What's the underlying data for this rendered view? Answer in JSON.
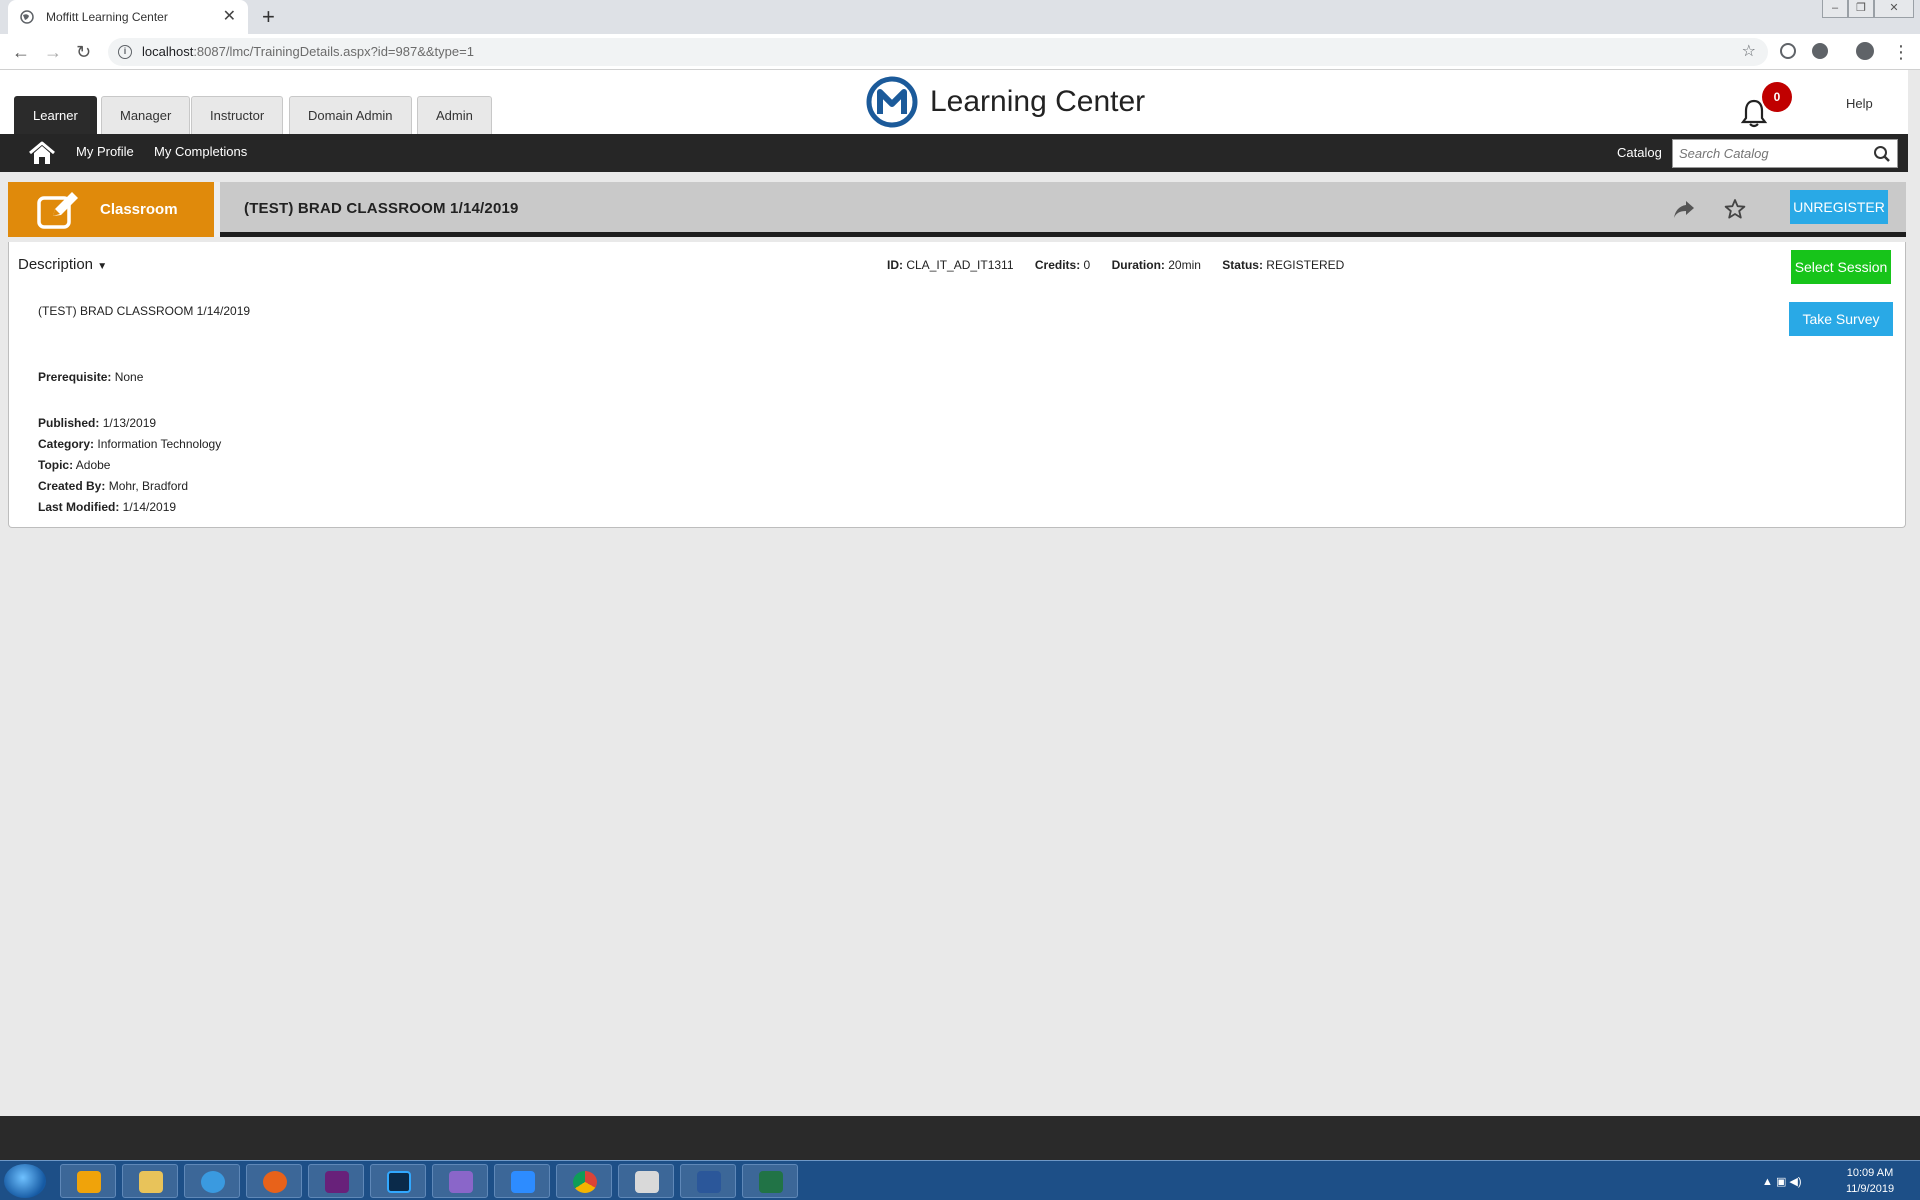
{
  "browser": {
    "tab_title": "Moffitt Learning Center",
    "tab_close": "✕",
    "new_tab": "+",
    "url_host": "localhost",
    "url_path": ":8087/lmc/TrainingDetails.aspx?id=987&&type=1"
  },
  "app": {
    "brand_name": "Learning Center",
    "role_tabs": [
      "Learner",
      "Manager",
      "Instructor",
      "Domain Admin",
      "Admin"
    ],
    "active_role": "Learner",
    "notification_count": "0",
    "help_label": "Help",
    "subnav": {
      "my_profile": "My Profile",
      "my_completions": "My Completions",
      "catalog": "Catalog",
      "search_placeholder": "Search Catalog"
    }
  },
  "course": {
    "category": "Classroom",
    "title": "(TEST) BRAD CLASSROOM 1/14/2019",
    "unregister_label": "UNREGISTER",
    "description_toggle": "Description",
    "meta": {
      "id_label": "ID:",
      "id_value": "CLA_IT_AD_IT1311",
      "credits_label": "Credits:",
      "credits_value": "0",
      "duration_label": "Duration:",
      "duration_value": "20min",
      "status_label": "Status:",
      "status_value": "REGISTERED"
    },
    "select_session_label": "Select Session",
    "take_survey_label": "Take Survey",
    "description": "(TEST) BRAD CLASSROOM 1/14/2019",
    "fields": {
      "prerequisite_label": "Prerequisite:",
      "prerequisite_value": "None",
      "published_label": "Published:",
      "published_value": "1/13/2019",
      "category_label": "Category:",
      "category_value": "Information Technology",
      "topic_label": "Topic:",
      "topic_value": "Adobe",
      "created_by_label": "Created By:",
      "created_by_value": "Mohr, Bradford",
      "last_modified_label": "Last Modified:",
      "last_modified_value": "1/14/2019"
    }
  },
  "taskbar": {
    "time": "10:09 AM",
    "date": "11/9/2019"
  },
  "colors": {
    "category_tile": "#e08a0b",
    "unregister": "#29a9e6",
    "select_session": "#17c41a",
    "take_survey": "#29a9e6",
    "badge": "#c00000"
  }
}
